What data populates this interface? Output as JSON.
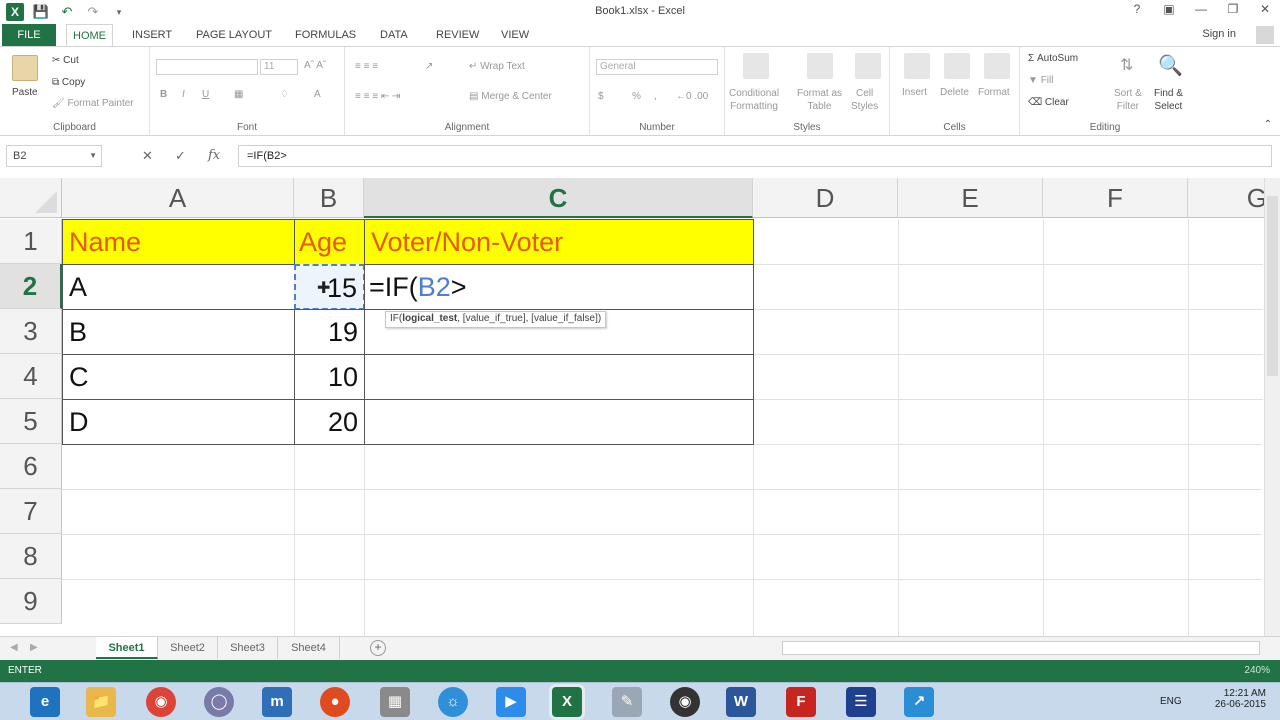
{
  "window": {
    "title": "Book1.xlsx - Excel"
  },
  "ribbon": {
    "tabs": [
      "FILE",
      "HOME",
      "INSERT",
      "PAGE LAYOUT",
      "FORMULAS",
      "DATA",
      "REVIEW",
      "VIEW"
    ],
    "active_tab": "HOME",
    "sign_in": "Sign in",
    "clipboard": {
      "paste": "Paste",
      "cut": "Cut",
      "copy": "Copy",
      "format_painter": "Format Painter",
      "label": "Clipboard"
    },
    "font": {
      "name": "",
      "size": "11",
      "label": "Font",
      "bold": "B",
      "italic": "I",
      "underline": "U"
    },
    "alignment": {
      "wrap_text": "Wrap Text",
      "merge_center": "Merge & Center",
      "label": "Alignment"
    },
    "number": {
      "format": "General",
      "label": "Number",
      "percent": "%"
    },
    "styles": {
      "conditional": "Conditional\nFormatting",
      "format_table": "Format as\nTable",
      "cell_styles": "Cell\nStyles",
      "label": "Styles"
    },
    "cells": {
      "insert": "Insert",
      "delete": "Delete",
      "format": "Format",
      "label": "Cells"
    },
    "editing": {
      "autosum": "AutoSum",
      "fill": "Fill",
      "clear": "Clear",
      "sort_filter": "Sort &\nFilter",
      "find_select": "Find &\nSelect",
      "label": "Editing"
    }
  },
  "formula_bar": {
    "name_box": "B2",
    "cancel": "✕",
    "enter": "✓",
    "fx": "fx",
    "content": "=IF(B2>"
  },
  "sheet": {
    "columns": [
      "A",
      "B",
      "C",
      "D",
      "E",
      "F",
      "G"
    ],
    "rows": [
      "1",
      "2",
      "3",
      "4",
      "5",
      "6",
      "7",
      "8",
      "9"
    ],
    "selected_column": "C",
    "selected_row": "2",
    "cells": {
      "A1": "Name",
      "B1": "Age",
      "C1": "Voter/Non-Voter",
      "A2": "A",
      "B2": "15",
      "C2_prefix": "=IF(",
      "C2_ref": "B2",
      "C2_suffix": ">",
      "A3": "B",
      "B3": "19",
      "A4": "C",
      "B4": "10",
      "A5": "D",
      "B5": "20"
    },
    "tooltip": {
      "fn": "IF(",
      "arg1": "logical_test",
      "rest": ", [value_if_true], [value_if_false])"
    },
    "header_fill": "#ffff00",
    "header_text_color": "#e8590c",
    "ref_color": "#4a7fd4"
  },
  "sheet_tabs": [
    "Sheet1",
    "Sheet2",
    "Sheet3",
    "Sheet4"
  ],
  "active_sheet": "Sheet1",
  "status": {
    "mode": "ENTER",
    "zoom": "240%"
  },
  "taskbar": {
    "lang": "ENG",
    "time": "12:21 AM",
    "date": "26-06-2015"
  },
  "colors": {
    "excel_green": "#217346"
  }
}
